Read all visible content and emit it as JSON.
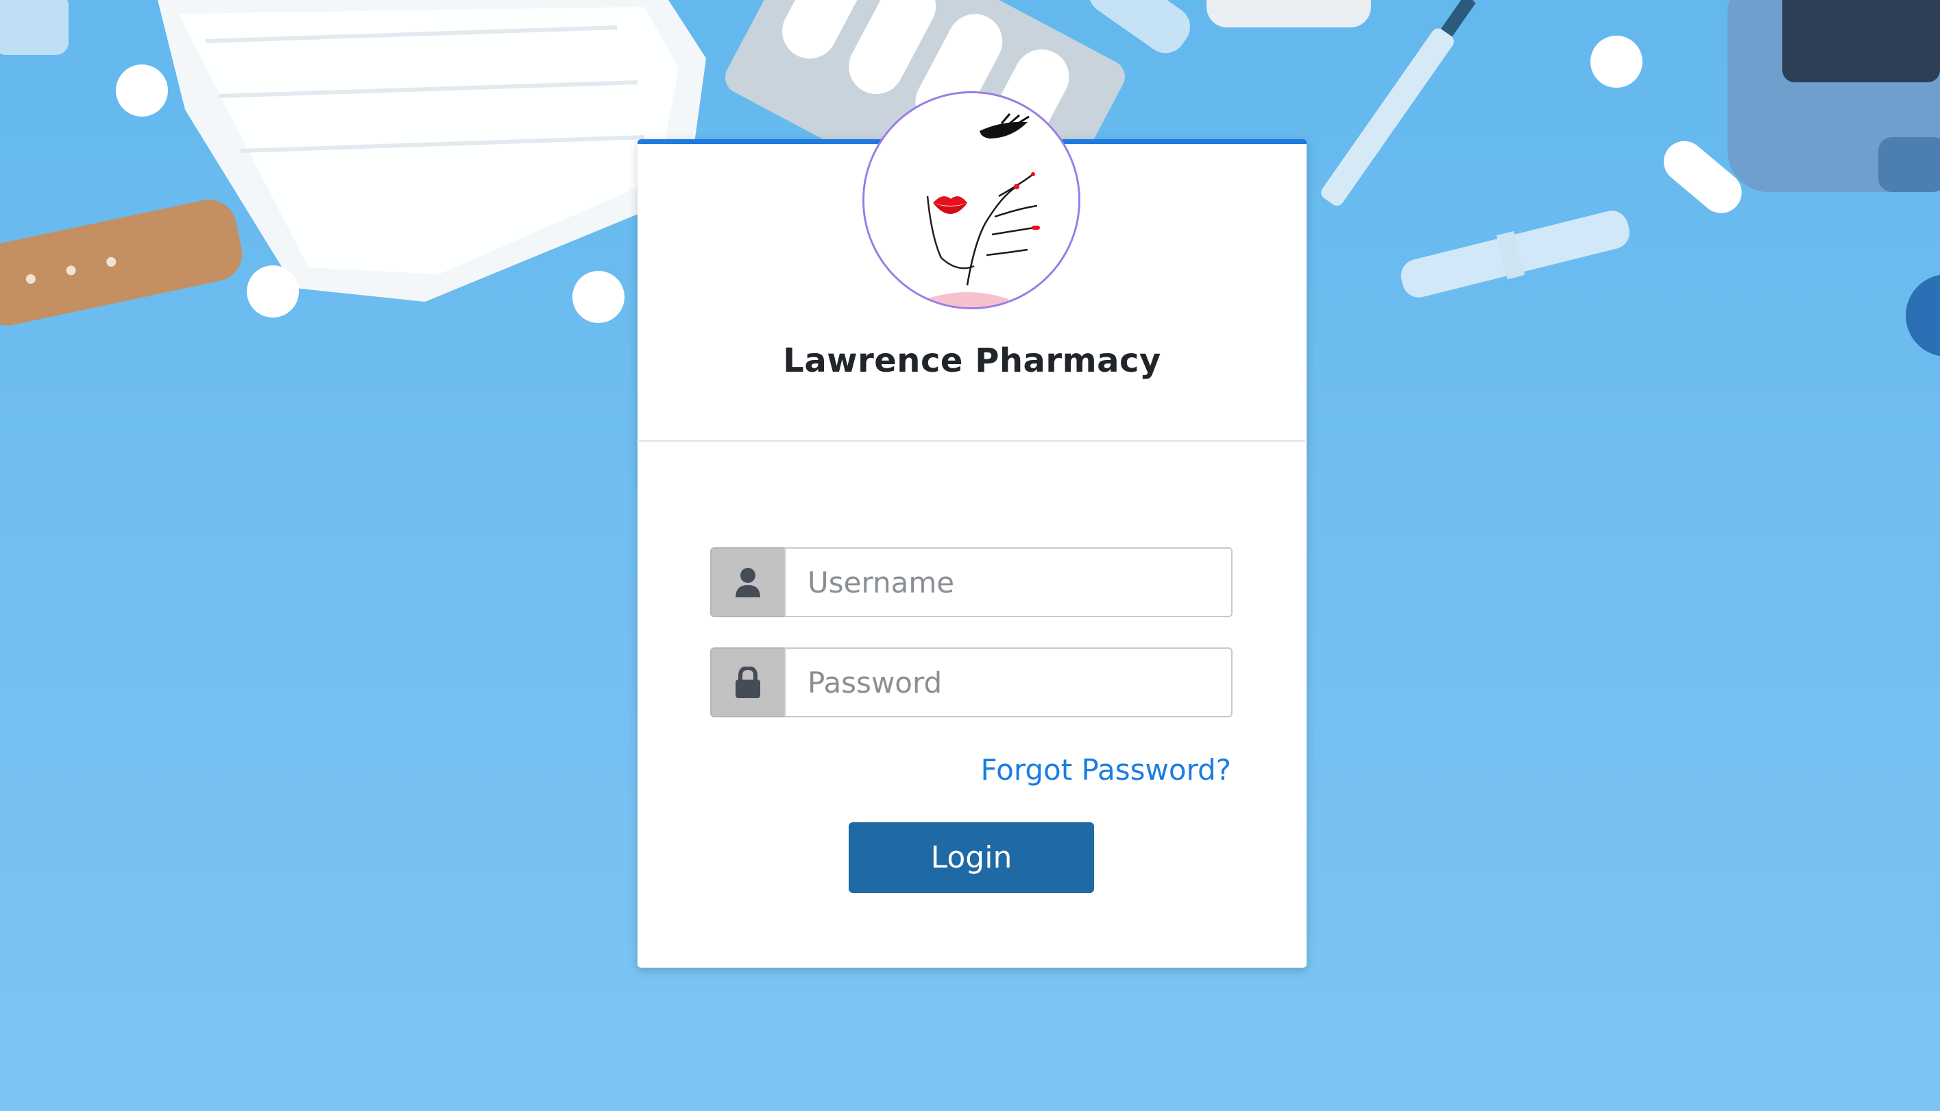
{
  "brand": {
    "name": "Lawrence Pharmacy",
    "logo_icon": "lips-hand-logo-icon"
  },
  "login_form": {
    "username": {
      "value": "",
      "placeholder": "Username",
      "icon": "user-icon"
    },
    "password": {
      "value": "",
      "placeholder": "Password",
      "icon": "lock-icon"
    },
    "forgot_password_label": "Forgot Password?",
    "login_label": "Login"
  },
  "colors": {
    "accent": "#1f7ae0",
    "login_button": "#1f6aa5",
    "link": "#1a7de2",
    "background": "#6fbdf0"
  }
}
